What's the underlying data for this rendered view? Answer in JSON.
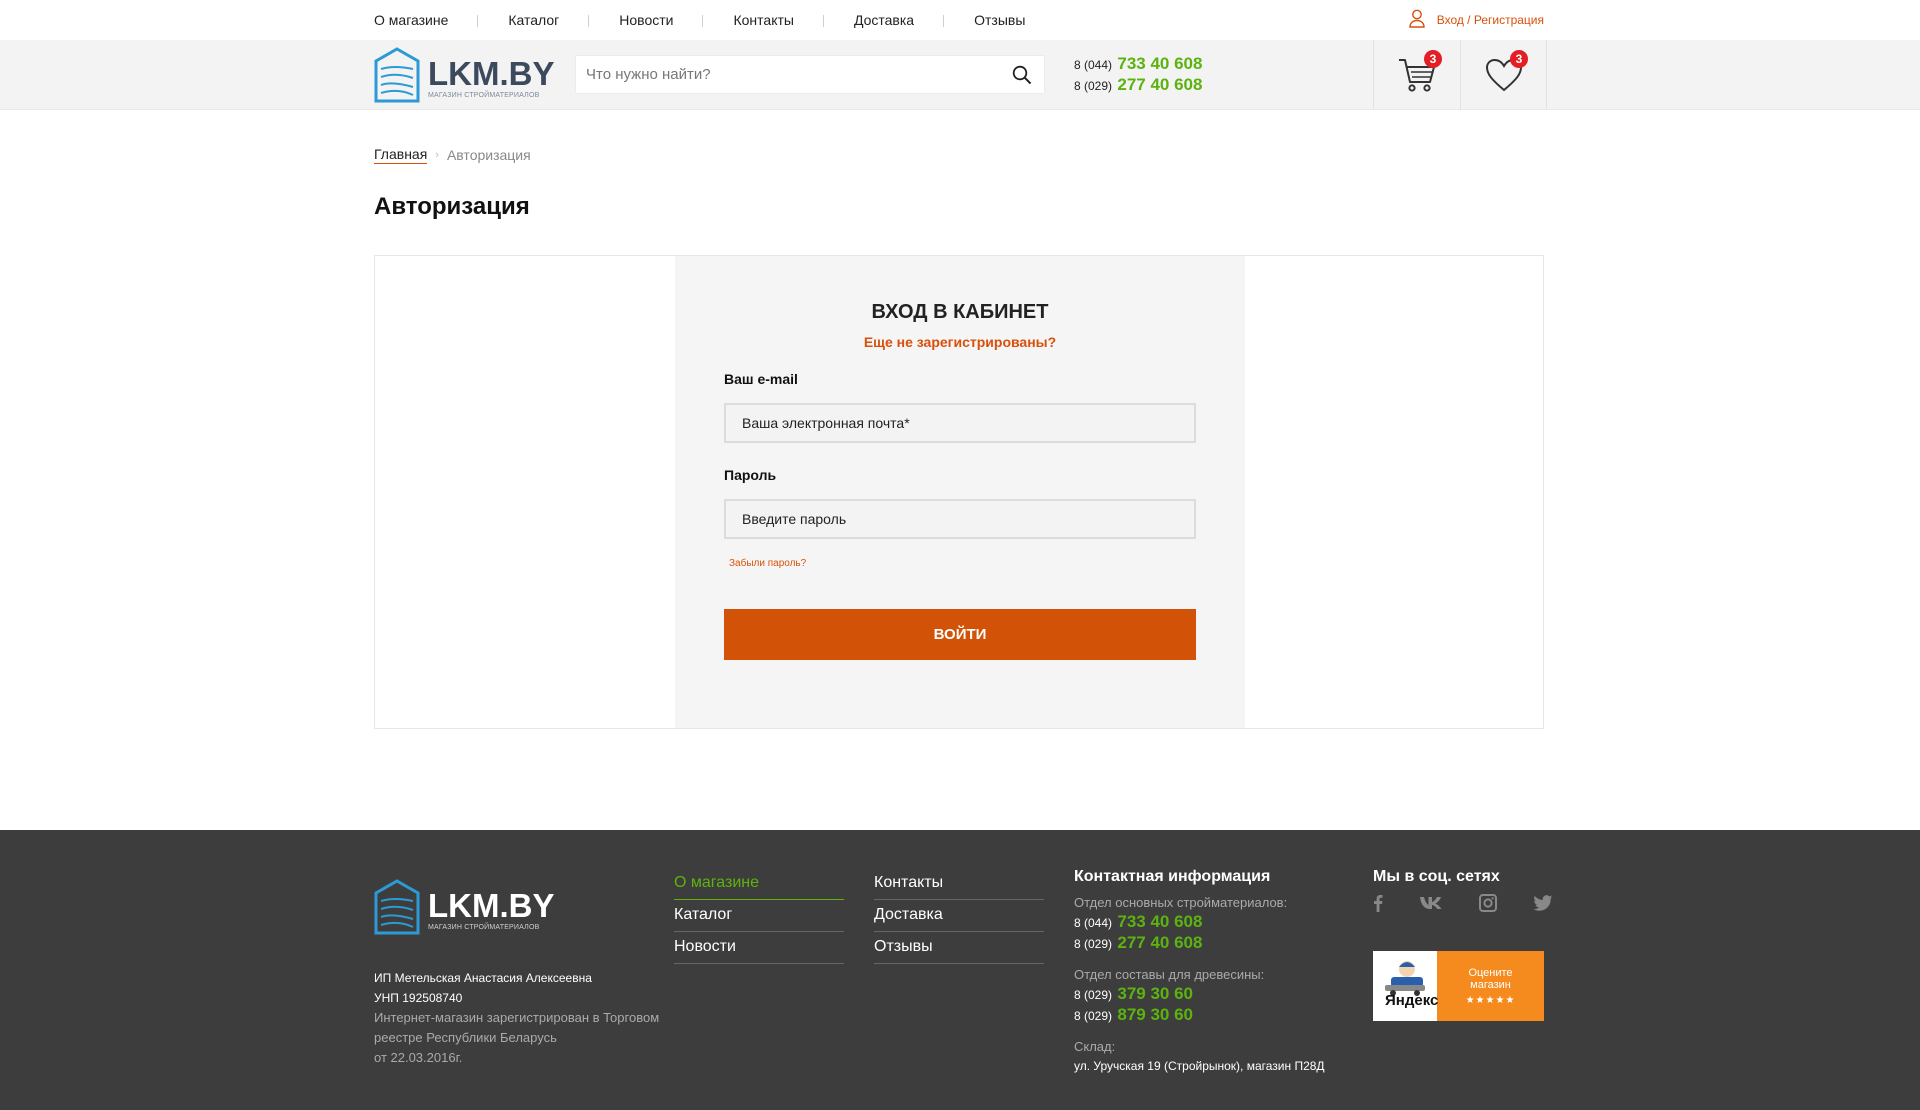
{
  "topnav": {
    "items": [
      "О магазине",
      "Каталог",
      "Новости",
      "Контакты",
      "Доставка",
      "Отзывы"
    ],
    "login_label": "Вход / Регистрация"
  },
  "header": {
    "logo_title": "LKM.BY",
    "logo_subtitle": "МАГАЗИН СТРОЙМАТЕРИАЛОВ",
    "search_placeholder": "Что нужно найти?",
    "phones": [
      {
        "code": "8 (044)",
        "number": "733 40 608"
      },
      {
        "code": "8 (029)",
        "number": "277 40 608"
      }
    ],
    "cart_count": "3",
    "wishlist_count": "3"
  },
  "breadcrumb": {
    "home": "Главная",
    "separator": "›",
    "current": "Авторизация"
  },
  "page_title": "Авторизация",
  "login_form": {
    "title": "ВХОД В КАБИНЕТ",
    "register_link": "Еще не зарегистрированы?",
    "email_label": "Ваш e-mail",
    "email_placeholder": "Ваша электронная почта*",
    "password_label": "Пароль",
    "password_placeholder": "Введите пароль",
    "forgot_link": "Забыли пароль?",
    "submit_label": "ВОЙТИ"
  },
  "footer": {
    "logo_title": "LKM.BY",
    "logo_subtitle": "МАГАЗИН СТРОЙМАТЕРИАЛОВ",
    "legal_name": "ИП Метельская Анастасия Алексеевна",
    "unp": "УНП 192508740",
    "registry_line1": "Интернет-магазин зарегистрирован в Торговом",
    "registry_line2": "реестре Республики Беларусь",
    "registry_line3": "от 22.03.2016г.",
    "menu_col1": [
      "О магазине",
      "Каталог",
      "Новости"
    ],
    "menu_col2": [
      "Контакты",
      "Доставка",
      "Отзывы"
    ],
    "contact_heading": "Контактная информация",
    "dept1_label": "Отдел основных стройматериалов:",
    "dept1_phones": [
      {
        "code": "8 (044)",
        "number": "733 40 608"
      },
      {
        "code": "8 (029)",
        "number": "277 40 608"
      }
    ],
    "dept2_label": "Отдел составы для древесины:",
    "dept2_phones": [
      {
        "code": "8 (029)",
        "number": "379 30 60"
      },
      {
        "code": "8 (029)",
        "number": "879 30 60"
      }
    ],
    "warehouse_label": "Склад:",
    "warehouse_address": "ул. Уручская 19 (Стройрынок), магазин П28Д",
    "social_heading": "Мы в соц. сетях",
    "social_icons": [
      "facebook-icon",
      "vk-icon",
      "instagram-icon",
      "twitter-icon"
    ],
    "yandex_label": "Яндекс",
    "yandex_rate_line1": "Оцените",
    "yandex_rate_line2": "магазин",
    "yandex_stars": "★★★★★"
  },
  "colors": {
    "accent_orange": "#d25207",
    "accent_green": "#5cb30f",
    "footer_bg": "#3d3d3d",
    "badge_red": "#e31e24"
  }
}
